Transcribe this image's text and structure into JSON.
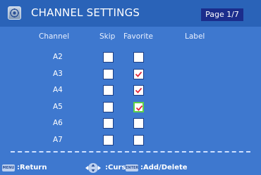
{
  "header": {
    "title": "CHANNEL SETTINGS",
    "page": "Page 1/7"
  },
  "columns": {
    "channel": "Channel",
    "skip": "Skip",
    "favorite": "Favorite",
    "label": "Label"
  },
  "rows": [
    {
      "channel": "A2",
      "skip": false,
      "favorite": false
    },
    {
      "channel": "A3",
      "skip": false,
      "favorite": true
    },
    {
      "channel": "A4",
      "skip": false,
      "favorite": true
    },
    {
      "channel": "A5",
      "skip": false,
      "favorite": true,
      "focused": true
    },
    {
      "channel": "A6",
      "skip": false,
      "favorite": false
    },
    {
      "channel": "A7",
      "skip": false,
      "favorite": false
    }
  ],
  "footer": {
    "menu_key": "MENU",
    "return_label": ":Return",
    "cursor_label": ":Cursor",
    "enter_key": "ENTER",
    "add_label": ":Add/Delete"
  },
  "colors": {
    "background": "#3e78cf",
    "title_bar": "#2a63b8",
    "page_badge": "#1b2d8c",
    "check_mark": "#e0283c",
    "focus_outline": "#5fd04a"
  }
}
